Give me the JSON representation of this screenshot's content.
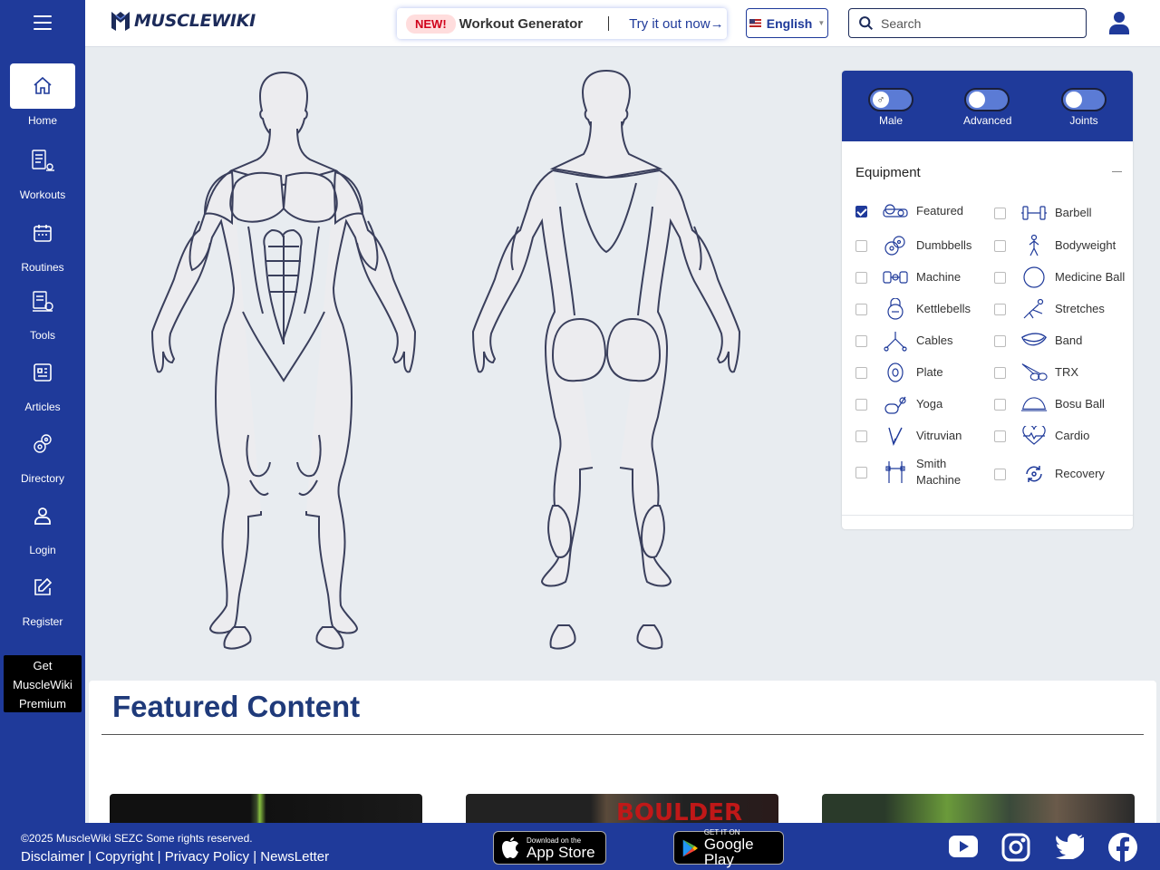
{
  "sidebar": {
    "items": [
      {
        "label": "Home",
        "icon": "home-icon",
        "active": true
      },
      {
        "label": "Workouts",
        "icon": "workouts-icon"
      },
      {
        "label": "Routines",
        "icon": "calendar-icon"
      },
      {
        "label": "Tools",
        "icon": "tools-icon"
      },
      {
        "label": "Articles",
        "icon": "articles-icon"
      },
      {
        "label": "Directory",
        "icon": "directory-icon"
      },
      {
        "label": "Login",
        "icon": "user-icon"
      },
      {
        "label": "Register",
        "icon": "edit-icon"
      }
    ],
    "premium_line1": "Get",
    "premium_line2": "MuscleWiki",
    "premium_line3": "Premium"
  },
  "header": {
    "logo_text": "MUSCLEWIKI",
    "promo_badge": "NEW!",
    "promo_title": "Workout Generator",
    "promo_cta": "Try it out now",
    "promo_cta_arrow": "→",
    "language": "English",
    "search_placeholder": "Search"
  },
  "filters": {
    "toggles": [
      {
        "label": "Male",
        "knob": "♂"
      },
      {
        "label": "Advanced",
        "knob": ""
      },
      {
        "label": "Joints",
        "knob": ""
      }
    ],
    "equipment_heading": "Equipment",
    "equipment_left": [
      {
        "label": "Featured",
        "checked": true,
        "icon": "featured-icon"
      },
      {
        "label": "Dumbbells",
        "checked": false,
        "icon": "dumbbells-icon"
      },
      {
        "label": "Machine",
        "checked": false,
        "icon": "machine-icon"
      },
      {
        "label": "Kettlebells",
        "checked": false,
        "icon": "kettlebell-icon"
      },
      {
        "label": "Cables",
        "checked": false,
        "icon": "cables-icon"
      },
      {
        "label": "Plate",
        "checked": false,
        "icon": "plate-icon"
      },
      {
        "label": "Yoga",
        "checked": false,
        "icon": "yoga-icon"
      },
      {
        "label": "Vitruvian",
        "checked": false,
        "icon": "vitruvian-icon"
      },
      {
        "label": "Smith Machine",
        "checked": false,
        "icon": "smith-machine-icon"
      }
    ],
    "equipment_right": [
      {
        "label": "Barbell",
        "checked": false,
        "icon": "barbell-icon"
      },
      {
        "label": "Bodyweight",
        "checked": false,
        "icon": "bodyweight-icon"
      },
      {
        "label": "Medicine Ball",
        "checked": false,
        "icon": "medicine-ball-icon"
      },
      {
        "label": "Stretches",
        "checked": false,
        "icon": "stretches-icon"
      },
      {
        "label": "Band",
        "checked": false,
        "icon": "band-icon"
      },
      {
        "label": "TRX",
        "checked": false,
        "icon": "trx-icon"
      },
      {
        "label": "Bosu Ball",
        "checked": false,
        "icon": "bosu-ball-icon"
      },
      {
        "label": "Cardio",
        "checked": false,
        "icon": "cardio-icon"
      },
      {
        "label": "Recovery",
        "checked": false,
        "icon": "recovery-icon"
      }
    ]
  },
  "featured": {
    "title": "Featured Content",
    "card2_overlay": "BOULDER"
  },
  "footer": {
    "copyright": "©2025 MuscleWiki SEZC Some rights reserved.",
    "links": [
      "Disclaimer",
      "Copyright",
      "Privacy Policy",
      "NewsLetter"
    ],
    "separator": " | ",
    "appstore_small": "Download on the",
    "appstore_big": "App Store",
    "googleplay_small": "GET IT ON",
    "googleplay_big": "Google Play",
    "social": [
      "youtube-icon",
      "instagram-icon",
      "twitter-icon",
      "facebook-icon"
    ]
  },
  "colors": {
    "brand": "#1f3a9a",
    "badge_red": "#d0021b",
    "body_fill": "#ececef",
    "body_stroke": "#3a3f5c"
  }
}
